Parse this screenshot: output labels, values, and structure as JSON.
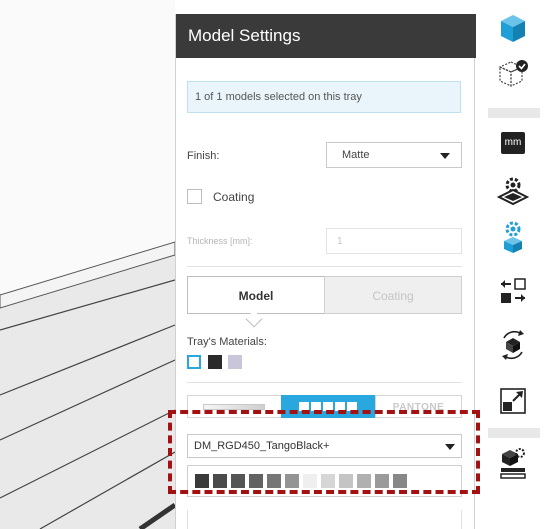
{
  "panel": {
    "title": "Model Settings",
    "selection_info": "1 of 1 models selected on this tray",
    "finish_label": "Finish:",
    "finish_value": "Matte",
    "coating_checkbox_label": "Coating",
    "coating_checked": false,
    "thickness_label": "Thickness [mm]:",
    "thickness_value": "1",
    "tabs": [
      {
        "label": "Model",
        "active": true
      },
      {
        "label": "Coating",
        "active": false
      }
    ],
    "trays_materials_label": "Tray's Materials:",
    "tray_swatches": [
      "#ffffff",
      "#2a2a2a",
      "#c9c6da"
    ],
    "color_modes": {
      "gradient": "gradient-picker",
      "grid": "grid-palette-picker",
      "pantone_label": "PANTONE",
      "active": "grid"
    },
    "material_value": "DM_RGD450_TangoBlack+",
    "palette_colors": [
      "#3a3a3a",
      "#4a4a4a",
      "#555555",
      "#626262",
      "#767676",
      "#949494",
      "#efefef",
      "#d6d6d6",
      "#c4c4c4",
      "#b0b0b0",
      "#9a9a9a",
      "#878787"
    ],
    "highlight_color": "#a31212"
  },
  "sidebar": {
    "items": [
      {
        "icon": "cube-icon",
        "color": "#1f9fd8"
      },
      {
        "icon": "cube-check-icon"
      },
      {
        "icon": "mm-units-icon",
        "label": "mm"
      },
      {
        "icon": "gear-tray-icon"
      },
      {
        "icon": "gear-cube-icon",
        "color": "#1f9fd8"
      },
      {
        "icon": "swap-arrows-icon"
      },
      {
        "icon": "rotate-icon"
      },
      {
        "icon": "scale-icon"
      },
      {
        "icon": "model-settings-icon"
      }
    ]
  }
}
